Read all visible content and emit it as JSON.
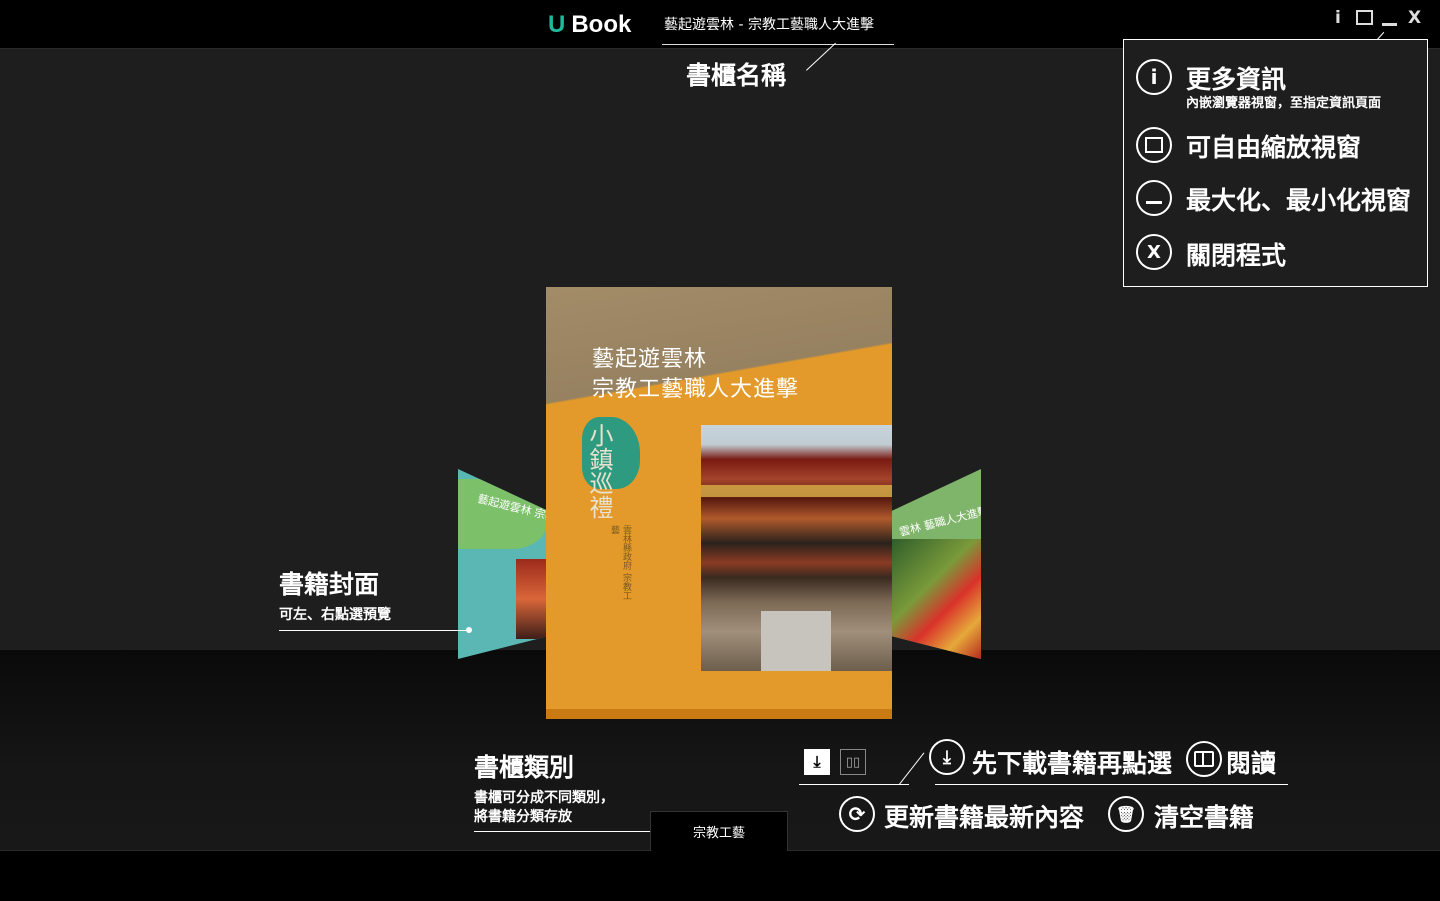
{
  "app": {
    "logo_u": "U",
    "logo_text": "Book"
  },
  "title_bar": {
    "shelf_name": "藝起遊雲林 - 宗教工藝職人大進擊",
    "buttons": [
      "i",
      "☐",
      "—",
      "X"
    ]
  },
  "books": {
    "center": {
      "title_line1": "藝起遊雲林",
      "title_line2": "宗教工藝職人大進擊",
      "vertical_text": "小鎮巡禮",
      "small_text": "雲林縣政府 宗教工藝"
    },
    "left": {
      "title": "藝起遊雲林 宗教工藝職人"
    },
    "right": {
      "title": "雲林 藝職人大進擊"
    }
  },
  "annotations": {
    "shelf_name": {
      "title": "書櫃名稱"
    },
    "book_cover": {
      "title": "書籍封面",
      "sub": "可左、右點選預覽"
    },
    "shelf_category": {
      "title": "書櫃類別",
      "sub_line1": "書櫃可分成不同類別，",
      "sub_line2": "將書籍分類存放"
    },
    "info_box": {
      "more_info": {
        "icon": "i",
        "label": "更多資訊",
        "sub": "內嵌瀏覽器視窗，至指定資訊頁面"
      },
      "resize": {
        "icon": "☐",
        "label": "可自由縮放視窗"
      },
      "min_max": {
        "icon": "—",
        "label": "最大化、最小化視窗"
      },
      "close": {
        "icon": "X",
        "label": "關閉程式"
      }
    },
    "download_read": {
      "dl_label": "先下載書籍再點選",
      "read_label": "閱讀"
    },
    "update_clear": {
      "update_label": "更新書籍最新內容",
      "clear_label": "清空書籍"
    }
  },
  "category_tab": {
    "label": "宗教工藝"
  },
  "colors": {
    "accent": "#1fb89a",
    "book_cover": "#e39a2b"
  }
}
